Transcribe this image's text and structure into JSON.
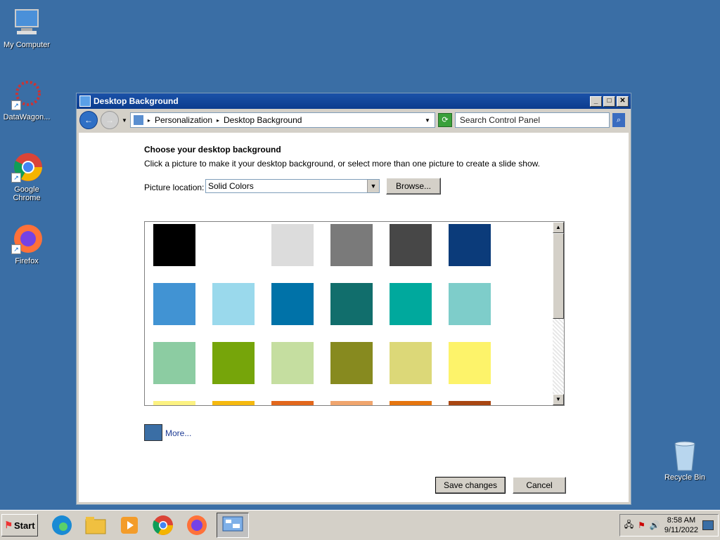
{
  "desktop": {
    "icons": [
      {
        "label": "My Computer",
        "icon": "computer-icon"
      },
      {
        "label": "DataWagon...",
        "icon": "datawagon-icon"
      },
      {
        "label": "Google Chrome",
        "icon": "chrome-icon"
      },
      {
        "label": "Firefox",
        "icon": "firefox-icon"
      },
      {
        "label": "Recycle Bin",
        "icon": "recycle-bin-icon"
      }
    ]
  },
  "window": {
    "title": "Desktop Background",
    "address": {
      "crumb1": "Personalization",
      "crumb2": "Desktop Background"
    },
    "search_placeholder": "Search Control Panel",
    "heading": "Choose your desktop background",
    "description": "Click a picture to make it your desktop background, or select more than one picture to create a slide show.",
    "location_label": "Picture location:",
    "location_value": "Solid Colors",
    "browse_label": "Browse...",
    "more_label": "More...",
    "save_label": "Save changes",
    "cancel_label": "Cancel",
    "swatches": [
      "#000000",
      "#ffffff",
      "#dcdcdc",
      "#7a7a7a",
      "#474747",
      "#0b3b7a",
      "#4193d3",
      "#9ad9ec",
      "#0072a8",
      "#116e6c",
      "#00a99d",
      "#7ecdca",
      "#8ccca2",
      "#76a50a",
      "#c5dea0",
      "#878a1f",
      "#dcd878",
      "#fdf36a",
      "#fcf281",
      "#f5b90f",
      "#e2671c",
      "#f0a56e",
      "#e5750f",
      "#a84612"
    ]
  },
  "taskbar": {
    "start_label": "Start",
    "time": "8:58 AM",
    "date": "9/11/2022"
  }
}
